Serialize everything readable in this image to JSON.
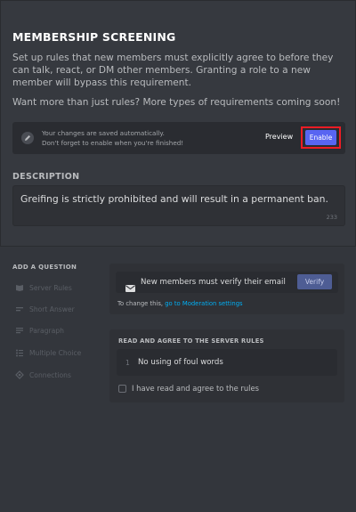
{
  "header": {
    "title": "MEMBERSHIP SCREENING",
    "description": "Set up rules that new members must explicitly agree to before they can talk, react, or DM other members. Granting a role to a new member will bypass this requirement.",
    "more": "Want more than just rules? More types of requirements coming soon!"
  },
  "save_bar": {
    "line1": "Your changes are saved automatically.",
    "line2": "Don't forget to enable when you're finished!",
    "preview_label": "Preview",
    "enable_label": "Enable"
  },
  "description_section": {
    "label": "DESCRIPTION",
    "value": "Greifing is strictly prohibited and will result in a permanent ban.",
    "char_count": "233"
  },
  "add_question": {
    "label": "ADD A QUESTION",
    "items": [
      {
        "label": "Server Rules",
        "icon": "book-icon"
      },
      {
        "label": "Short Answer",
        "icon": "short-lines-icon"
      },
      {
        "label": "Paragraph",
        "icon": "paragraph-icon"
      },
      {
        "label": "Multiple Choice",
        "icon": "list-icon"
      },
      {
        "label": "Connections",
        "icon": "connections-icon"
      }
    ]
  },
  "verify_card": {
    "text": "New members must verify their email",
    "button": "Verify",
    "change_prefix": "To change this, ",
    "change_link": "go to Moderation settings"
  },
  "rules_card": {
    "heading": "READ AND AGREE TO THE SERVER RULES",
    "rules": [
      {
        "num": "1",
        "text": "No using of foul words"
      }
    ],
    "agree_label": "I have read and agree to the rules"
  },
  "colors": {
    "background": "#36393f",
    "accent": "#5865f2",
    "highlight": "#ed1c24",
    "link": "#00aff4"
  }
}
